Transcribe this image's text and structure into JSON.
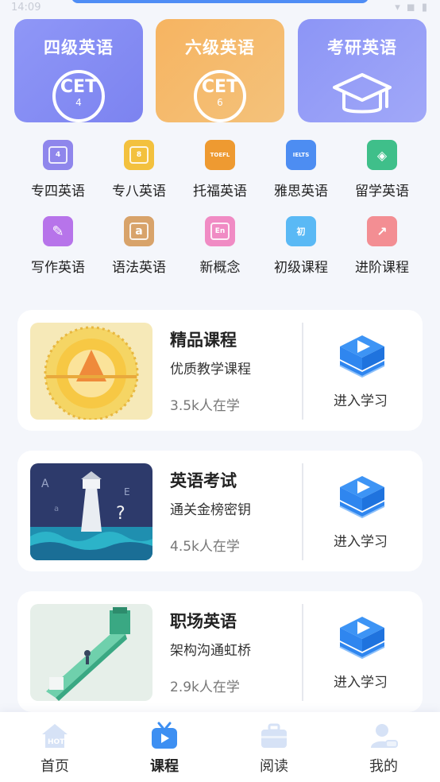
{
  "status_bar": {
    "time": "14:09",
    "icons": "▾ ◼ ▮"
  },
  "exam_cards": [
    {
      "title": "四级英语",
      "badge_main": "CET",
      "badge_sub": "4"
    },
    {
      "title": "六级英语",
      "badge_main": "CET",
      "badge_sub": "6"
    },
    {
      "title": "考研英语",
      "badge_main": "",
      "badge_sub": ""
    }
  ],
  "categories": [
    {
      "label": "专四英语",
      "icon_text": "4",
      "color": "#8f86ec"
    },
    {
      "label": "专八英语",
      "icon_text": "8",
      "color": "#f3c13e"
    },
    {
      "label": "托福英语",
      "icon_text": "TOEFL",
      "color": "#ee9a31"
    },
    {
      "label": "雅思英语",
      "icon_text": "IELTS",
      "color": "#4d8df2"
    },
    {
      "label": "留学英语",
      "icon_text": "◈",
      "color": "#3fbf8a"
    },
    {
      "label": "写作英语",
      "icon_text": "✎",
      "color": "#b774ea"
    },
    {
      "label": "语法英语",
      "icon_text": "a",
      "color": "#d8a36a"
    },
    {
      "label": "新概念",
      "icon_text": "En",
      "color": "#f08bc4"
    },
    {
      "label": "初级课程",
      "icon_text": "初",
      "color": "#5ab9f5"
    },
    {
      "label": "进阶课程",
      "icon_text": "↗",
      "color": "#f38e93"
    }
  ],
  "courses": [
    {
      "name": "精品课程",
      "desc": "优质教学课程",
      "count": "3.5k人在学",
      "enter": "进入学习"
    },
    {
      "name": "英语考试",
      "desc": "通关金榜密钥",
      "count": "4.5k人在学",
      "enter": "进入学习"
    },
    {
      "name": "职场英语",
      "desc": "架构沟通虹桥",
      "count": "2.9k人在学",
      "enter": "进入学习"
    }
  ],
  "tabs": [
    {
      "label": "首页",
      "icon": "home-hot-icon"
    },
    {
      "label": "课程",
      "icon": "tv-play-icon"
    },
    {
      "label": "阅读",
      "icon": "briefcase-icon"
    },
    {
      "label": "我的",
      "icon": "user-icon"
    }
  ],
  "colors": {
    "accent": "#4f8df5",
    "card_purple": "#8f97f7",
    "card_orange": "#f6b461"
  }
}
